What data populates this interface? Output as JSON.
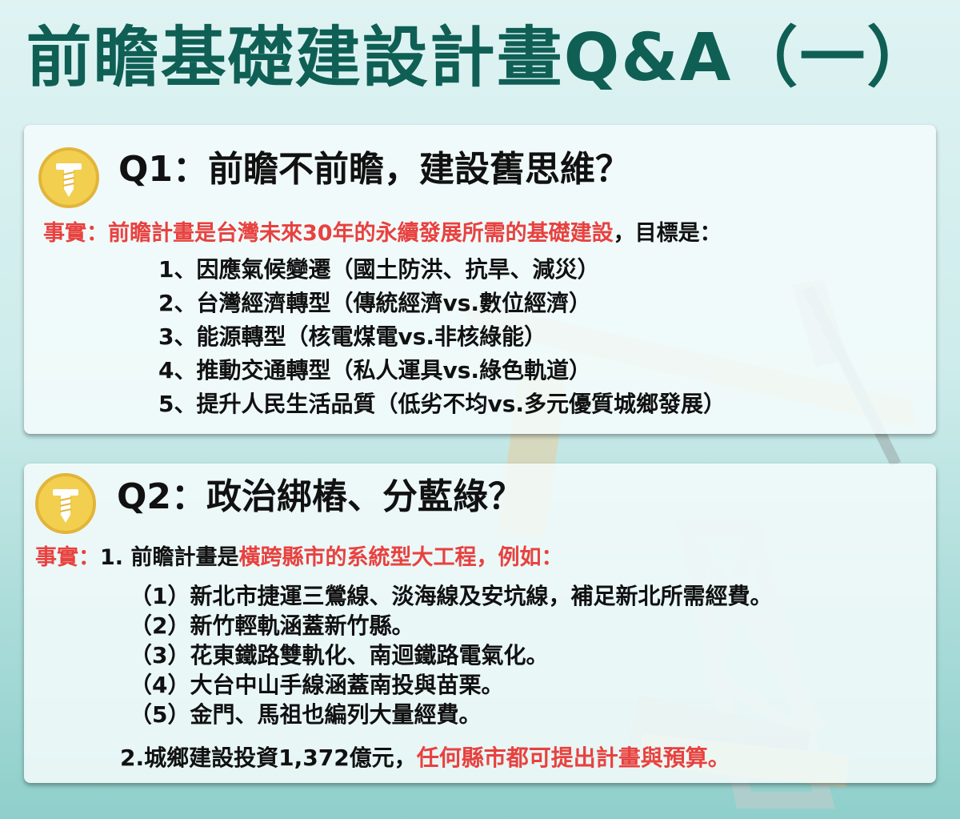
{
  "title": "前瞻基礎建設計畫Q&A（一）",
  "colors": {
    "title": "#0f5f55",
    "highlight_red": "#e8413f",
    "screw_icon": "#f3cf4f"
  },
  "q1": {
    "icon": "screw-icon",
    "heading": "Q1：前瞻不前瞻，建設舊思維？",
    "fact_label": "事實：",
    "fact_highlight": "前瞻計畫是台灣未來30年的永續發展所需的基礎建設",
    "fact_tail": "，目標是：",
    "items": [
      "1、因應氣候變遷（國土防洪、抗旱、減災）",
      "2、台灣經濟轉型（傳統經濟vs.數位經濟）",
      "3、能源轉型（核電煤電vs.非核綠能）",
      "4、推動交通轉型（私人運具vs.綠色軌道）",
      "5、提升人民生活品質（低劣不均vs.多元優質城鄉發展）"
    ]
  },
  "q2": {
    "icon": "screw-icon",
    "heading": "Q2：政治綁樁、分藍綠？",
    "fact_label": "事實：",
    "point1_prefix": "1. 前瞻計畫是",
    "point1_highlight": "橫跨縣市的系統型大工程，例如：",
    "items": [
      "（1）新北市捷運三鶯線、淡海線及安坑線，補足新北所需經費。",
      "（2）新竹輕軌涵蓋新竹縣。",
      "（3）花東鐵路雙軌化、南迴鐵路電氣化。",
      "（4）大台中山手線涵蓋南投與苗栗。",
      "（5）金門、馬祖也編列大量經費。"
    ],
    "point2_prefix": "2.城鄉建設投資1,372億元，",
    "point2_highlight": "任何縣市都可提出計畫與預算。"
  }
}
